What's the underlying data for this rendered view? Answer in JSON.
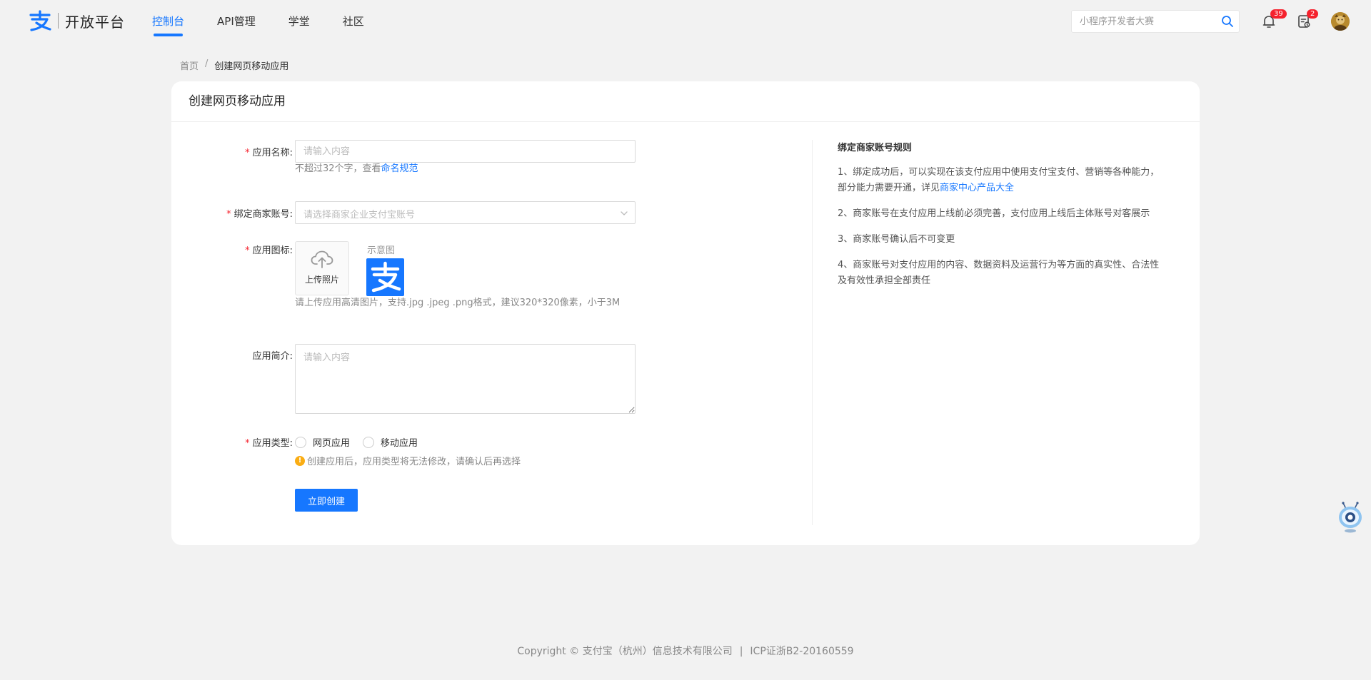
{
  "header": {
    "logo_text": "开放平台",
    "nav": [
      {
        "label": "控制台",
        "active": true
      },
      {
        "label": "API管理",
        "active": false
      },
      {
        "label": "学堂",
        "active": false
      },
      {
        "label": "社区",
        "active": false
      }
    ],
    "search_placeholder": "小程序开发者大赛",
    "notifications_count": "39",
    "tasks_count": "2"
  },
  "breadcrumb": {
    "home": "首页",
    "separator": "/",
    "current": "创建网页移动应用"
  },
  "card": {
    "title": "创建网页移动应用",
    "form": {
      "required_mark": "*",
      "app_name": {
        "label": "应用名称:",
        "placeholder": "请输入内容",
        "help_prefix": "不超过32个字，查看",
        "help_link": "命名规范"
      },
      "merchant": {
        "label": "绑定商家账号:",
        "placeholder": "请选择商家企业支付宝账号"
      },
      "icon": {
        "label": "应用图标:",
        "upload_label": "上传照片",
        "sample_label": "示意图",
        "help": "请上传应用高清图片，支持.jpg .jpeg .png格式，建议320*320像素，小于3M"
      },
      "description": {
        "label": "应用简介:",
        "placeholder": "请输入内容"
      },
      "app_type": {
        "label": "应用类型:",
        "options": [
          "网页应用",
          "移动应用"
        ],
        "warning_icon": "!",
        "warning": "创建应用后，应用类型将无法修改，请确认后再选择"
      },
      "submit_label": "立即创建"
    },
    "rules": {
      "title": "绑定商家账号规则",
      "items": [
        {
          "text": "1、绑定成功后，可以实现在该支付应用中使用支付宝支付、营销等各种能力，部分能力需要开通，详见",
          "link": "商家中心产品大全"
        },
        {
          "text": "2、商家账号在支付应用上线前必须完善，支付应用上线后主体账号对客展示"
        },
        {
          "text": "3、商家账号确认后不可变更"
        },
        {
          "text": "4、商家账号对支付应用的内容、数据资料及运营行为等方面的真实性、合法性及有效性承担全部责任"
        }
      ]
    }
  },
  "footer": {
    "copyright": "Copyright © 支付宝（杭州）信息技术有限公司",
    "separator": "|",
    "icp": "ICP证浙B2-20160559"
  },
  "colors": {
    "primary": "#1677ff",
    "required": "#f5222d",
    "warning": "#faad14",
    "background": "#f2f2f2"
  },
  "icons": [
    "alipay-logo-icon",
    "search-icon",
    "bell-icon",
    "task-icon",
    "avatar",
    "upload-cloud-icon",
    "chevron-down-icon",
    "warning-icon",
    "robot-assistant-icon"
  ]
}
